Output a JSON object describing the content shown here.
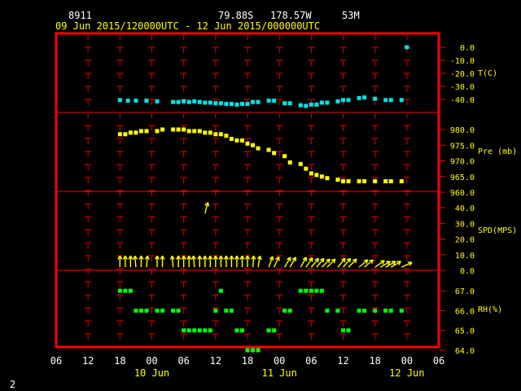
{
  "header": {
    "station": "8911",
    "latitude": "79.88S",
    "longitude": "178.57W",
    "elevation": "53M",
    "period": "09 Jun 2015/120000UTC - 12 Jun 2015/000000UTC"
  },
  "corner_label": "2",
  "colors": {
    "frame": "#ff0000",
    "separator": "#ff0000",
    "tick_marks": "#ff0000",
    "temperature": "#00e5e5",
    "pressure": "#ffff00",
    "wind": "#ffff00",
    "humidity": "#00ff00",
    "text": "#ffff00",
    "header_text": "#ffffff"
  },
  "chart_data": {
    "type": "scatter",
    "x_axis": {
      "unit": "hours from 09 Jun 06 UTC",
      "range": [
        0,
        72
      ],
      "tick_labels": [
        "06",
        "12",
        "18",
        "00",
        "06",
        "12",
        "18",
        "00",
        "06",
        "12",
        "18",
        "00",
        "06"
      ],
      "tick_hours": [
        0,
        6,
        12,
        18,
        24,
        30,
        36,
        42,
        48,
        54,
        60,
        66,
        72
      ],
      "date_labels": [
        {
          "label": "10 Jun",
          "hour": 18
        },
        {
          "label": "11 Jun",
          "hour": 42
        },
        {
          "label": "12 Jun",
          "hour": 66
        }
      ]
    },
    "panels": [
      {
        "id": "temperature",
        "label": "T(C)",
        "ylim": [
          -50,
          5
        ],
        "ticks": [
          "0.0",
          "-10.0",
          "-20.0",
          "-30.0",
          "-40.0"
        ],
        "tick_values": [
          0,
          -10,
          -20,
          -30,
          -40
        ],
        "x": [
          12,
          13.5,
          15,
          17,
          19,
          22,
          23,
          24,
          25,
          26,
          27,
          28,
          29,
          30,
          31,
          32,
          33,
          34,
          35,
          36,
          37,
          38,
          40,
          41,
          43,
          44,
          46,
          47,
          48,
          49,
          50,
          51,
          53,
          54,
          55,
          57,
          58,
          60,
          62,
          63,
          65
        ],
        "y": [
          -40.5,
          -41,
          -41,
          -41,
          -41.5,
          -42,
          -42,
          -41.5,
          -42,
          -41.5,
          -42,
          -42.5,
          -42.5,
          -43,
          -43,
          -43.5,
          -43.5,
          -44,
          -43.5,
          -43.5,
          -42,
          -42,
          -41,
          -41,
          -43,
          -43,
          -44.5,
          -45,
          -44,
          -44,
          -42.5,
          -42.5,
          -41.5,
          -40.5,
          -40.5,
          -39,
          -38.5,
          -39.5,
          -40.5,
          -40.5,
          -40.5,
          -40
        ],
        "extra_points": [
          {
            "x": 66,
            "y": 0
          }
        ]
      },
      {
        "id": "pressure",
        "label": "Pre (mb)",
        "ylim": [
          960,
          985
        ],
        "ticks": [
          "980.0",
          "975.0",
          "970.0",
          "965.0",
          "960.0"
        ],
        "tick_values": [
          980,
          975,
          970,
          965,
          960
        ],
        "x": [
          12,
          13,
          14,
          15,
          16,
          17,
          19,
          20,
          22,
          23,
          24,
          25,
          26,
          27,
          28,
          29,
          30,
          31,
          32,
          33,
          34,
          35,
          36,
          37,
          38,
          40,
          41,
          43,
          44,
          46,
          47,
          48,
          49,
          50,
          51,
          53,
          54,
          55,
          57,
          58,
          60,
          62,
          63,
          65
        ],
        "y": [
          978.5,
          978.5,
          979,
          979,
          979.5,
          979.5,
          979.5,
          980,
          980,
          980,
          980,
          979.5,
          979.5,
          979.5,
          979,
          979,
          978.5,
          978.5,
          978,
          977,
          976.5,
          976.5,
          975.5,
          975,
          974,
          973.5,
          972.5,
          971.5,
          969.5,
          969,
          967.5,
          966,
          965.5,
          965,
          964.5,
          964,
          963.5,
          963.5,
          963.5,
          963.5,
          963.5,
          963.5,
          963.5,
          963.5
        ]
      },
      {
        "id": "wind",
        "label": "SPD(MPS)",
        "ylim": [
          -2,
          50
        ],
        "ticks": [
          "40.0",
          "30.0",
          "20.0",
          "10.0",
          "0.0"
        ],
        "tick_values": [
          40,
          30,
          20,
          10,
          0
        ],
        "x": [
          12,
          13,
          14,
          15,
          16,
          17,
          19,
          20,
          22,
          23,
          24,
          25,
          26,
          27,
          28,
          29,
          30,
          31,
          32,
          33,
          34,
          35,
          36,
          37,
          38,
          40,
          41,
          43,
          44,
          46,
          47,
          48,
          49,
          50,
          51,
          53,
          54,
          55,
          57,
          58,
          60,
          61,
          62,
          63,
          65,
          28
        ],
        "speed": [
          8,
          9,
          9,
          8,
          9,
          8,
          8,
          9,
          9,
          9,
          8,
          8,
          9,
          8,
          9,
          9,
          9,
          9,
          9,
          9,
          8,
          8,
          9,
          9,
          10,
          10,
          10,
          10,
          9,
          9,
          9,
          9,
          10,
          10,
          11,
          11,
          12,
          12,
          11,
          11,
          10,
          9,
          9,
          9,
          8,
          40
        ],
        "direction_deg": [
          360,
          360,
          360,
          355,
          360,
          5,
          360,
          360,
          355,
          360,
          360,
          360,
          355,
          360,
          360,
          360,
          360,
          360,
          360,
          360,
          360,
          360,
          360,
          5,
          10,
          20,
          25,
          30,
          30,
          30,
          35,
          40,
          40,
          45,
          45,
          40,
          40,
          45,
          50,
          50,
          55,
          60,
          60,
          60,
          65,
          15
        ]
      },
      {
        "id": "humidity",
        "label": "RH(%)",
        "ylim": [
          63.5,
          68.5
        ],
        "ticks": [
          "67.0",
          "66.0",
          "65.0",
          "64.0"
        ],
        "tick_values": [
          67,
          66,
          65,
          64
        ],
        "x": [
          12,
          13,
          14,
          15,
          16,
          17,
          19,
          20,
          22,
          23,
          24,
          25,
          26,
          27,
          28,
          29,
          30,
          31,
          32,
          33,
          34,
          35,
          36,
          37,
          38,
          40,
          41,
          43,
          44,
          46,
          47,
          48,
          49,
          50,
          51,
          53,
          54,
          55,
          57,
          58,
          60,
          62,
          63,
          65
        ],
        "y": [
          67,
          67,
          67,
          66,
          66,
          66,
          66,
          66,
          66,
          66,
          65,
          65,
          65,
          65,
          65,
          65,
          66,
          67,
          66,
          66,
          65,
          65,
          64,
          64,
          64,
          65,
          65,
          66,
          66,
          67,
          67,
          67,
          67,
          67,
          66,
          66,
          65,
          65,
          66,
          66,
          66,
          66,
          66,
          66
        ]
      }
    ]
  }
}
